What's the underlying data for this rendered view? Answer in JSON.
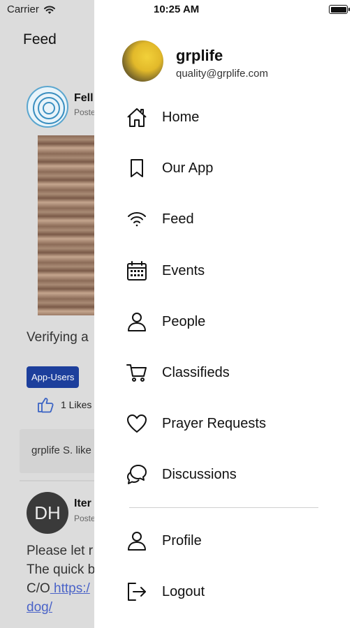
{
  "status_bar": {
    "carrier": "Carrier",
    "time": "10:25 AM"
  },
  "background_feed": {
    "title": "Feed",
    "post1": {
      "author": "Fell",
      "subtitle": "Poste",
      "text": "Verifying a",
      "tag": "App-Users",
      "likes": "1 Likes",
      "comment": "grplife S. like"
    },
    "post2": {
      "avatar_initials": "DH",
      "author": "Iter",
      "subtitle": "Poste",
      "text_line1": "Please let r",
      "text_line2": "The quick b",
      "text_line3_prefix": "C/O",
      "link_part1": " https:/",
      "link_part2": "dog/"
    }
  },
  "drawer": {
    "profile": {
      "name": "grplife",
      "email": "quality@grplife.com"
    },
    "menu": [
      {
        "label": "Home",
        "icon": "home-icon"
      },
      {
        "label": "Our App",
        "icon": "bookmark-icon"
      },
      {
        "label": "Feed",
        "icon": "wifi-icon"
      },
      {
        "label": "Events",
        "icon": "calendar-icon"
      },
      {
        "label": "People",
        "icon": "person-icon"
      },
      {
        "label": "Classifieds",
        "icon": "cart-icon"
      },
      {
        "label": "Prayer Requests",
        "icon": "heart-icon"
      },
      {
        "label": "Discussions",
        "icon": "chat-bubbles-icon"
      }
    ],
    "secondary_menu": [
      {
        "label": "Profile",
        "icon": "person-icon"
      },
      {
        "label": "Logout",
        "icon": "logout-icon"
      }
    ]
  },
  "colors": {
    "tag_background": "#1d3f9c",
    "link": "#4a63c8",
    "overlay": "#dcdcdc"
  }
}
